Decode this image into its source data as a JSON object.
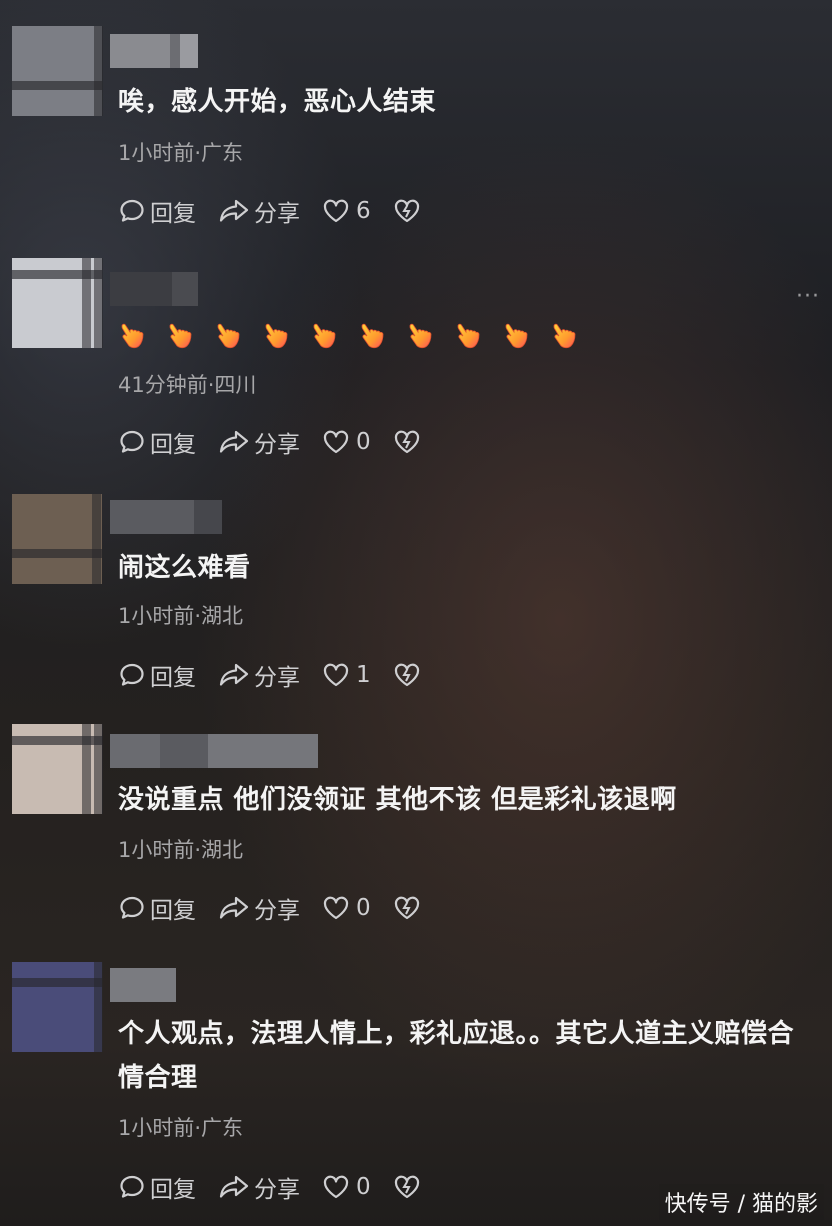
{
  "comments": [
    {
      "text": "唉，感人开始，恶心人结束",
      "meta": "1小时前·广东",
      "reply": "回复",
      "share": "分享",
      "likes": "6"
    },
    {
      "text": "",
      "emoji_icon": "pointing-finger-emoji",
      "emoji_count": 10,
      "meta": "41分钟前·四川",
      "reply": "回复",
      "share": "分享",
      "likes": "0"
    },
    {
      "text": "闹这么难看",
      "meta": "1小时前·湖北",
      "reply": "回复",
      "share": "分享",
      "likes": "1"
    },
    {
      "text": "没说重点 他们没领证 其他不该 但是彩礼该退啊",
      "meta": "1小时前·湖北",
      "reply": "回复",
      "share": "分享",
      "likes": "0"
    },
    {
      "text": "个人观点，法理人情上，彩礼应退。。其它人道主义赔偿合情合理",
      "meta": "1小时前·广东",
      "reply": "回复",
      "share": "分享",
      "likes": "0"
    }
  ],
  "more_menu": "···",
  "watermark": "快传号 / 猫的影",
  "colors": {
    "text": "#f4f4f4",
    "meta": "#a7a7a9",
    "action": "#cfcfd1",
    "avatar1": "#7c7e85",
    "avatar2": "#c9cbd0",
    "avatar3": "#6d5f52",
    "avatar4": "#c8bbb2",
    "avatar5": "#4a4c79"
  }
}
